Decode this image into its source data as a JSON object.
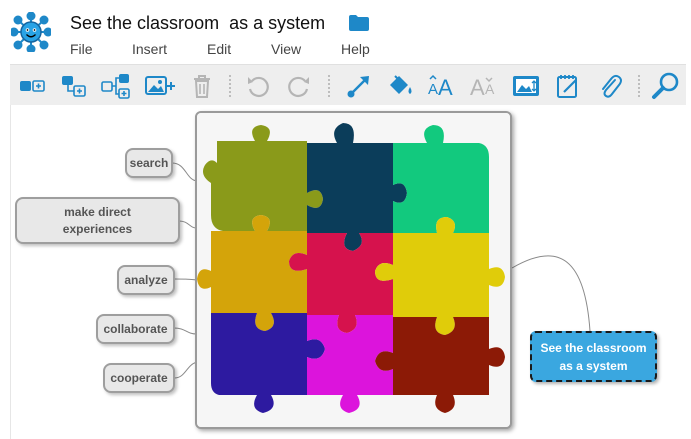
{
  "app": {
    "document_title": "See the classroom  as a system"
  },
  "menu": {
    "file": "File",
    "insert": "Insert",
    "edit": "Edit",
    "view": "View",
    "help": "Help"
  },
  "toolbar": {
    "icons": [
      "add-child-node-icon",
      "add-sibling-node-icon",
      "add-multiple-nodes-icon",
      "insert-image-icon",
      "delete-icon",
      "undo-icon",
      "redo-icon",
      "connector-icon",
      "fill-color-icon",
      "increase-font-icon",
      "decrease-font-icon",
      "fit-image-icon",
      "note-icon",
      "attachment-icon",
      "search-icon"
    ]
  },
  "map": {
    "central_node": "See the classroom\nas a system",
    "branches": [
      "search",
      "make direct\nexperiences",
      "analyze",
      "collaborate",
      "cooperate"
    ]
  },
  "colors": {
    "central_fill": "#3aa7e0",
    "toolbar_icon": "#1e88c8",
    "puzzle": [
      "#8a9a1a",
      "#0b3d5a",
      "#12c97e",
      "#d4a40a",
      "#d6124d",
      "#e0cc0a",
      "#2d1aa0",
      "#dc14dc",
      "#8c1a06"
    ]
  }
}
